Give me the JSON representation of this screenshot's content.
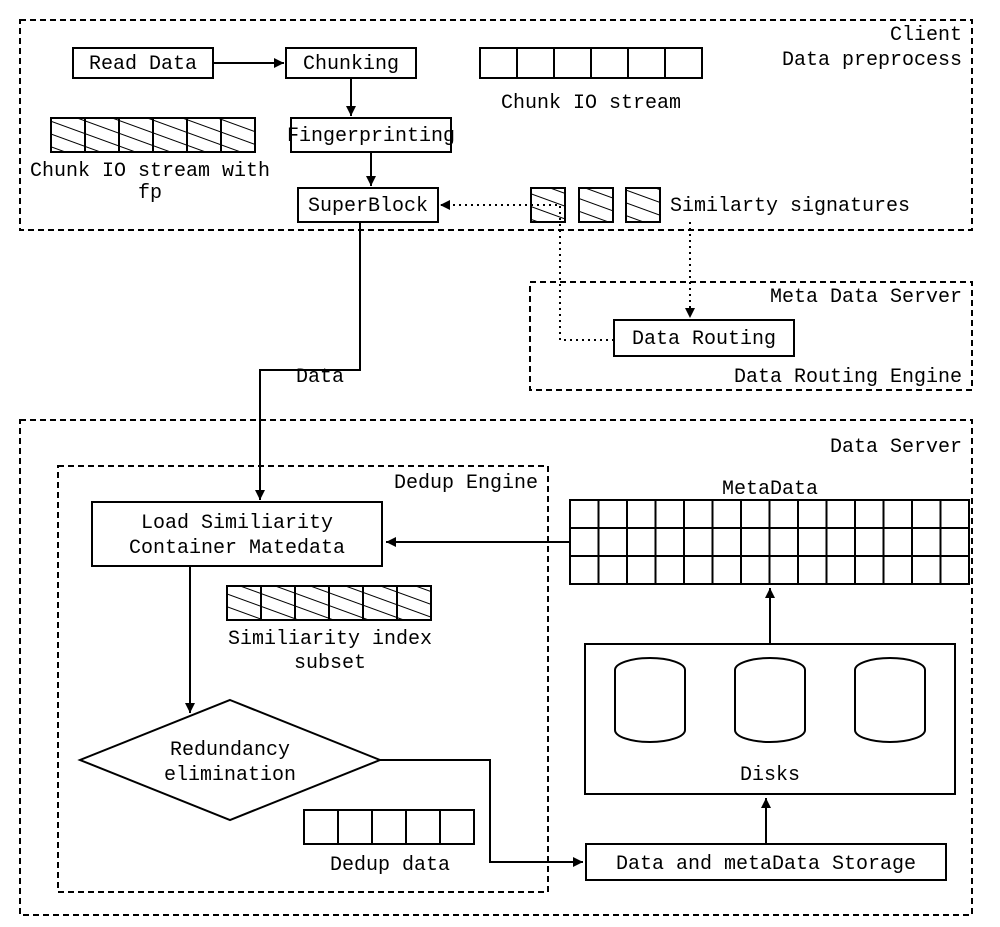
{
  "client": {
    "title1": "Client",
    "title2": "Data preprocess",
    "readData": "Read Data",
    "chunking": "Chunking",
    "fingerprinting": "Fingerprinting",
    "superblock": "SuperBlock",
    "chunkIO": "Chunk IO stream",
    "chunkIOfp1": "Chunk IO stream with",
    "chunkIOfp2": "fp",
    "similarty": "Similarty signatures"
  },
  "mds": {
    "title1": "Meta Data Server",
    "title2": "Data Routing Engine",
    "routing": "Data Routing"
  },
  "dataLabel": "Data",
  "ds": {
    "title": "Data Server",
    "dedupEngine": "Dedup Engine",
    "load1": "Load Similiarity",
    "load2": "Container Matedata",
    "simIdx1": "Similiarity index",
    "simIdx2": "subset",
    "redund1": "Redundancy",
    "redund2": "elimination",
    "dedupData": "Dedup data",
    "metaData": "MetaData",
    "disks": "Disks",
    "storage": "Data and metaData Storage"
  }
}
